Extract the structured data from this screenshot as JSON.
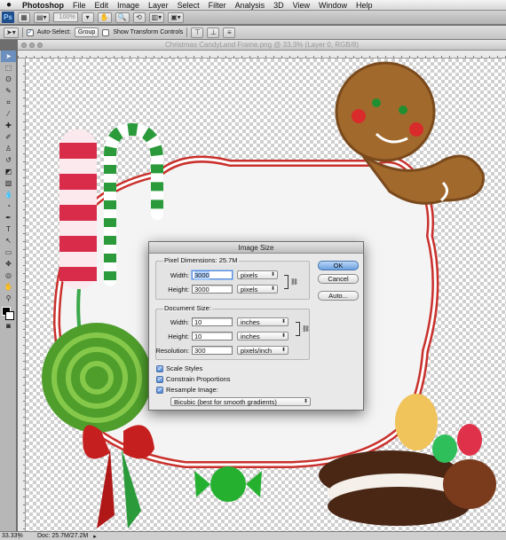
{
  "menubar": {
    "apple": "",
    "items": [
      "Photoshop",
      "File",
      "Edit",
      "Image",
      "Layer",
      "Select",
      "Filter",
      "Analysis",
      "3D",
      "View",
      "Window",
      "Help"
    ]
  },
  "appbar": {
    "ps_label": "Ps",
    "zoom": "100%"
  },
  "options": {
    "auto_select_label": "Auto-Select:",
    "auto_select_checked": true,
    "auto_select_mode": "Group",
    "show_transform_label": "Show Transform Controls",
    "show_transform_checked": false
  },
  "document": {
    "title": "Christmas CandyLand Frame.png @ 33.3% (Layer 0, RGB/8)"
  },
  "status": {
    "zoom": "33.33%",
    "doc_size": "Doc: 25.7M/27.2M"
  },
  "dialog": {
    "title": "Image Size",
    "pixel_dimensions_label": "Pixel Dimensions:",
    "pixel_dimensions_value": "25.7M",
    "width_label": "Width:",
    "width_px": "3000",
    "width_px_unit": "pixels",
    "height_label": "Height:",
    "height_px": "3000",
    "height_px_unit": "pixels",
    "document_size_label": "Document Size:",
    "doc_width": "10",
    "doc_width_unit": "inches",
    "doc_height": "10",
    "doc_height_unit": "inches",
    "resolution_label": "Resolution:",
    "resolution": "300",
    "resolution_unit": "pixels/inch",
    "ok_label": "OK",
    "cancel_label": "Cancel",
    "auto_label": "Auto...",
    "scale_styles_label": "Scale Styles",
    "scale_styles_checked": true,
    "constrain_label": "Constrain Proportions",
    "constrain_checked": true,
    "resample_label": "Resample Image:",
    "resample_checked": true,
    "resample_method": "Bicubic (best for smooth gradients)"
  }
}
